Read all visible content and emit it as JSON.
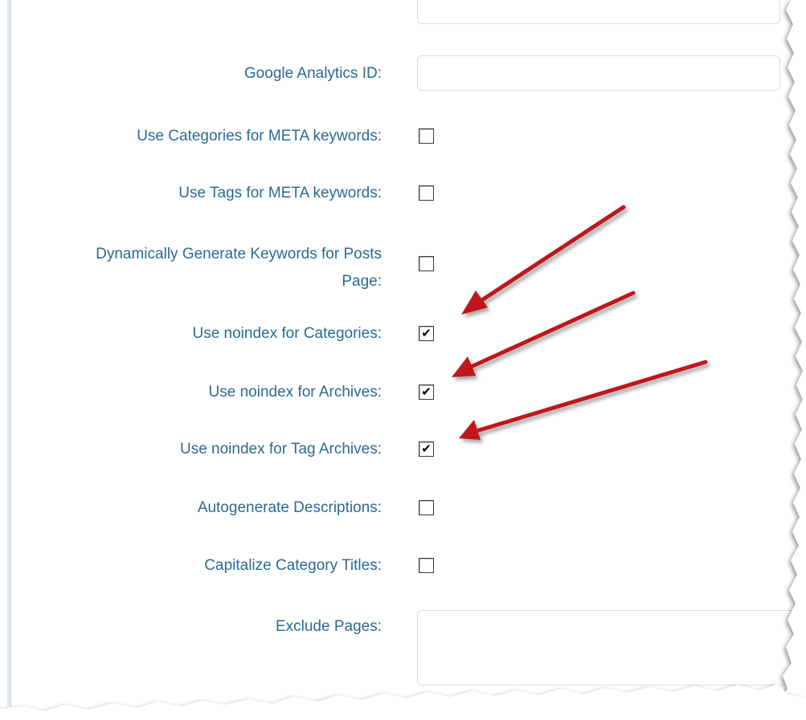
{
  "form": {
    "google_analytics_label": "Google Analytics ID:",
    "google_analytics_value": "",
    "categories_meta_label": "Use Categories for META keywords:",
    "categories_meta_checked": false,
    "tags_meta_label": "Use Tags for META keywords:",
    "tags_meta_checked": false,
    "dynamic_keywords_label": "Dynamically Generate Keywords for Posts Page:",
    "dynamic_keywords_checked": false,
    "noindex_categories_label": "Use noindex for Categories:",
    "noindex_categories_checked": true,
    "noindex_archives_label": "Use noindex for Archives:",
    "noindex_archives_checked": true,
    "noindex_tag_archives_label": "Use noindex for Tag Archives:",
    "noindex_tag_archives_checked": true,
    "autogenerate_descriptions_label": "Autogenerate Descriptions:",
    "autogenerate_descriptions_checked": false,
    "capitalize_titles_label": "Capitalize Category Titles:",
    "capitalize_titles_checked": false,
    "exclude_pages_label": "Exclude Pages:",
    "exclude_pages_value": ""
  },
  "style": {
    "label_color": "#2b6a91",
    "arrow_color": "#c0191c",
    "check_glyph": "✔"
  }
}
